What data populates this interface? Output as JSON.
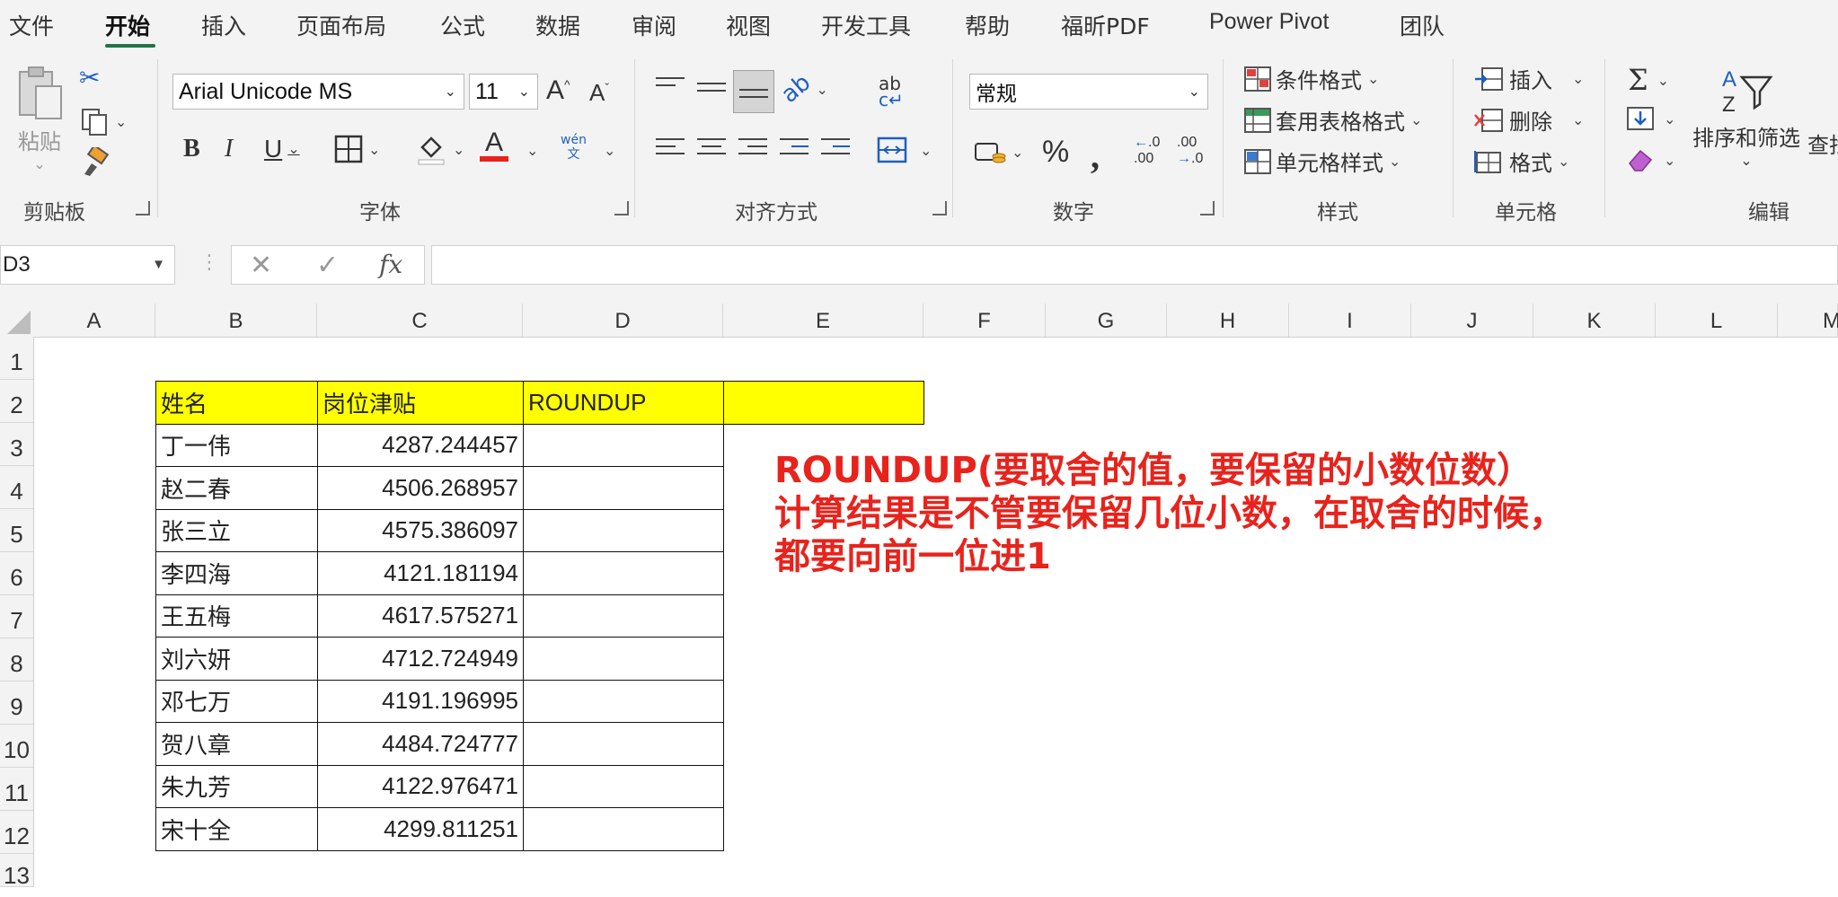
{
  "menu": {
    "items": [
      "文件",
      "开始",
      "插入",
      "页面布局",
      "公式",
      "数据",
      "审阅",
      "视图",
      "开发工具",
      "帮助",
      "福昕PDF",
      "Power Pivot",
      "团队"
    ],
    "active": "开始",
    "accent_color": "#217346"
  },
  "ribbon": {
    "clipboard": {
      "paste_label": "粘贴",
      "group_label": "剪贴板"
    },
    "font": {
      "font_name": "Arial Unicode MS",
      "font_size": "11",
      "group_label": "字体",
      "font_color": "#e8231c",
      "phonetic_top": "wén",
      "phonetic_bottom": "文"
    },
    "alignment": {
      "group_label": "对齐方式"
    },
    "number": {
      "format_value": "常规",
      "group_label": "数字"
    },
    "styles": {
      "conditional": "条件格式",
      "table": "套用表格格式",
      "cell": "单元格样式",
      "group_label": "样式"
    },
    "cells": {
      "insert": "插入",
      "delete": "删除",
      "format": "格式",
      "group_label": "单元格"
    },
    "editing": {
      "sort_filter": "排序和筛选",
      "find": "查找",
      "group_label": "编辑"
    }
  },
  "formula_bar": {
    "name_box": "D3",
    "formula": ""
  },
  "sheet": {
    "columns": [
      "A",
      "B",
      "C",
      "D",
      "E",
      "F",
      "G",
      "H",
      "I",
      "J",
      "K",
      "L",
      "M"
    ],
    "rows": [
      "1",
      "2",
      "3",
      "4",
      "5",
      "6",
      "7",
      "8",
      "9",
      "10",
      "11",
      "12",
      "13"
    ],
    "header": [
      "姓名",
      "岗位津贴",
      "ROUNDUP"
    ],
    "header_fill": "#ffff00",
    "data": [
      {
        "name": "丁一伟",
        "value": "4287.244457"
      },
      {
        "name": "赵二春",
        "value": "4506.268957"
      },
      {
        "name": "张三立",
        "value": "4575.386097"
      },
      {
        "name": "李四海",
        "value": "4121.181194"
      },
      {
        "name": "王五梅",
        "value": "4617.575271"
      },
      {
        "name": "刘六妍",
        "value": "4712.724949"
      },
      {
        "name": "邓七万",
        "value": "4191.196995"
      },
      {
        "name": "贺八章",
        "value": "4484.724777"
      },
      {
        "name": "朱九芳",
        "value": "4122.976471"
      },
      {
        "name": "宋十全",
        "value": "4299.811251"
      }
    ],
    "note_lines": [
      "ROUNDUP(要取舍的值，要保留的小数位数）",
      "计算结果是不管要保留几位小数，在取舍的时候，",
      "都要向前一位进1"
    ],
    "note_color": "#e8231c"
  }
}
